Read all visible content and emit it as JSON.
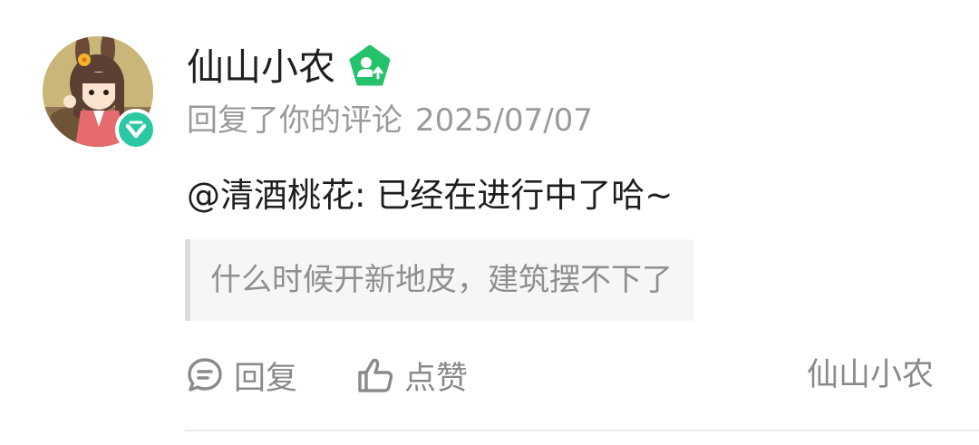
{
  "author": {
    "name": "仙山小农",
    "avatar_icon": "avatar-girl-illustration",
    "verified_badge_icon": "verified-check-icon",
    "verified_color": "#2cc8a4",
    "creator_icon": "creator-up-icon"
  },
  "notification": {
    "action_text": "回复了你的评论",
    "date": "2025/07/07"
  },
  "reply": {
    "text": "@清酒桃花: 已经在进行中了哈~"
  },
  "quoted_comment": {
    "text": "什么时候开新地皮，建筑摆不下了"
  },
  "actions": {
    "reply_label": "回复",
    "reply_icon": "comment-icon",
    "like_label": "点赞",
    "like_icon": "thumbs-up-icon",
    "source_label": "仙山小农"
  },
  "colors": {
    "primary_text": "#1f1f1f",
    "secondary_text": "#9a9a9a",
    "quote_bg": "#f5f6f7",
    "quote_bar": "#dcdcdc",
    "divider": "#ececec"
  }
}
